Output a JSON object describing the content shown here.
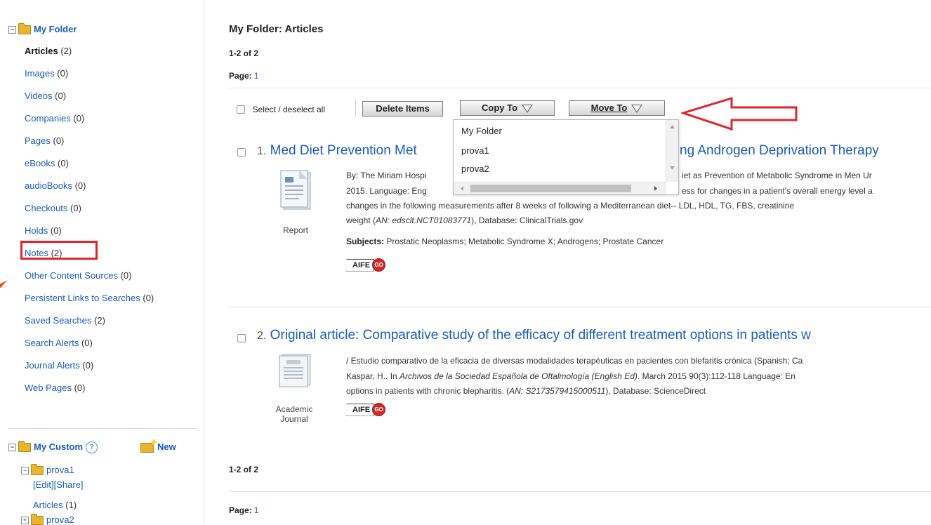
{
  "sidebar": {
    "my_folder": {
      "toggle": "−",
      "label": "My Folder",
      "items": [
        {
          "label": "Articles",
          "count": "(2)",
          "active": true
        },
        {
          "label": "Images",
          "count": "(0)"
        },
        {
          "label": "Videos",
          "count": "(0)"
        },
        {
          "label": "Companies",
          "count": "(0)"
        },
        {
          "label": "Pages",
          "count": "(0)"
        },
        {
          "label": "eBooks",
          "count": "(0)"
        },
        {
          "label": "audioBooks",
          "count": "(0)"
        },
        {
          "label": "Checkouts",
          "count": "(0)"
        },
        {
          "label": "Holds",
          "count": "(0)"
        },
        {
          "label": "Notes",
          "count": "(2)",
          "highlighted": true
        },
        {
          "label": "Other Content Sources",
          "count": "(0)"
        },
        {
          "label": "Persistent Links to Searches",
          "count": "(0)"
        },
        {
          "label": "Saved Searches",
          "count": "(2)"
        },
        {
          "label": "Search Alerts",
          "count": "(0)"
        },
        {
          "label": "Journal Alerts",
          "count": "(0)"
        },
        {
          "label": "Web Pages",
          "count": "(0)"
        }
      ]
    },
    "my_custom": {
      "toggle": "−",
      "label": "My Custom",
      "help": "?",
      "new_label": "New",
      "folders": [
        {
          "toggle": "−",
          "name": "prova1",
          "edit": "[Edit]",
          "share": "[Share]",
          "articles": "Articles",
          "articles_count": "(1)"
        },
        {
          "toggle": "+",
          "name": "prova2"
        }
      ]
    }
  },
  "main": {
    "title": "My Folder: Articles",
    "range_top": "1-2 of 2",
    "page_label": "Page:",
    "page_num": "1",
    "toolbar": {
      "select_all": "Select / deselect all",
      "delete": "Delete Items",
      "copy": "Copy To",
      "move": "Move To"
    },
    "dropdown": [
      "My Folder",
      "prova1",
      "prova2"
    ],
    "results": [
      {
        "num": "1.",
        "title_start": "Med Diet Prevention Met",
        "title_end": "ng Androgen Deprivation Therapy",
        "type": "Report",
        "line1_a": "By: The Miriam Hospi",
        "line1_b": "iet as Prevention of Metabolic Syndrome in Men Ur",
        "line2_a": "2015. Language: Eng",
        "line2_b": "ess for changes in a patient's overall energy level a",
        "line3": "changes in the following measurements after 8 weeks of following a Mediterranean diet-- LDL, HDL, TG, FBS, creatinine",
        "line4_pre": "weight (",
        "an_label": "AN:",
        "an": " edsclt.NCT01083771",
        "line4_post": "), Database: ClinicalTrials.gov",
        "subjects_label": "Subjects:",
        "subjects": " Prostatic Neoplasms; Metabolic Syndrome X; Androgens; Prostate Cancer",
        "aife": "AIFE",
        "go": "GO"
      },
      {
        "num": "2.",
        "title": "Original article: Comparative study of the efficacy of different treatment options in patients w",
        "type_line1": "Academic",
        "type_line2": "Journal",
        "line1": "/ Estudio comparativo de la eficacia de diversas modalidades terapéuticas en pacientes con blefaritis crónica (Spanish; Ca",
        "line2_pre": "Kaspar, H.. In ",
        "journal": "Archivos de la Sociedad Española de Oftalmología (English Ed)",
        "line2_post": ". March 2015 90(3):112-118 Language: En",
        "line3_pre": "options in patients with chronic blepharitis. (",
        "an_label": "AN:",
        "an": " S2173579415000511",
        "line3_post": "), Database: ScienceDirect",
        "aife": "AIFE",
        "go": "GO"
      }
    ],
    "range_bottom": "1-2 of 2",
    "page_label_bottom": "Page:",
    "page_num_bottom": "1"
  }
}
